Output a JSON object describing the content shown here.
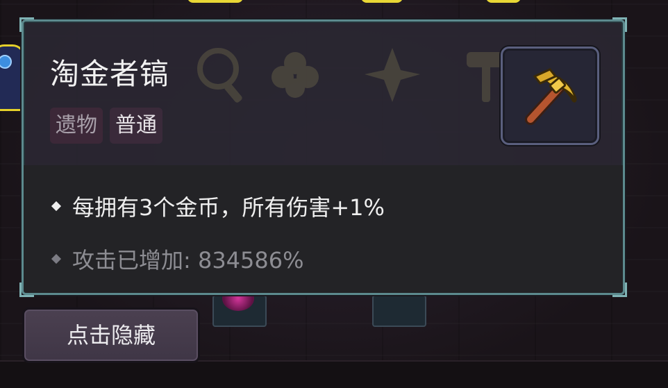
{
  "item": {
    "name": "淘金者镐",
    "tags": [
      "遗物",
      "普通"
    ],
    "icon": "pickaxe-icon"
  },
  "effects": [
    "每拥有3个金币，所有伤害+1%",
    "攻击已增加: 834586%"
  ],
  "buttons": {
    "hide_label": "点击隐藏"
  },
  "colors": {
    "border_teal": "#5c8a8e",
    "title_text": "#f1f1f1",
    "muted_text": "#8d8d93",
    "pickaxe_head": "#d9b02e",
    "pickaxe_handle": "#b5552f"
  }
}
